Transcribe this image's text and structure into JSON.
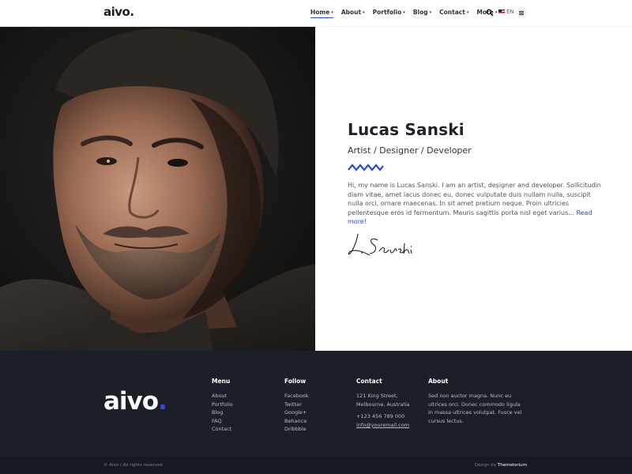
{
  "header": {
    "logo": "aivo.",
    "nav": [
      {
        "label": "Home",
        "active": true
      },
      {
        "label": "About"
      },
      {
        "label": "Portfolio"
      },
      {
        "label": "Blog"
      },
      {
        "label": "Contact"
      },
      {
        "label": "More"
      }
    ],
    "search_icon": "search-icon",
    "language": "EN",
    "menu_icon": "hamburger-icon"
  },
  "hero": {
    "name": "Lucas Sanski",
    "role": "Artist / Designer / Developer",
    "description": "Hi, my name is Lucas Sanski. I am an artist, designer and developer. Sollicitudin diam vitae, amet lacus donec eu, donec vulputate duis nullam nulla, suscipit nulla orci, ornare maecenas. In sit amet pretium neque. Proin ultricies pellentesque eros id fermentum. Mauris sagittis porta nisl eget varius...",
    "read_more": "Read more!",
    "signature": "L. Sanski",
    "accent_color": "#2d4bd4"
  },
  "footer": {
    "logo_text": "aivo",
    "logo_dot": ".",
    "menu": {
      "title": "Menu",
      "items": [
        "About",
        "Portfolio",
        "Blog",
        "FAQ",
        "Contact"
      ]
    },
    "follow": {
      "title": "Follow",
      "items": [
        "Facebook",
        "Twitter",
        "Google+",
        "Behance",
        "Dribbble"
      ]
    },
    "contact": {
      "title": "Contact",
      "address1": "121 King Street,",
      "address2": "Melbourne, Australia",
      "phone": "+123 456 789 000",
      "email": "info@youremail.com"
    },
    "about": {
      "title": "About",
      "text": "Sed non auctor magna. Nunc eu ultrices orci. Donec commodo ligula in massa ultrices volutpat. Fusce vel cursus lectus."
    },
    "copyright": "© Aivo / All rights reserved",
    "design_prefix": "Design by",
    "design_by": "Themetorium"
  }
}
